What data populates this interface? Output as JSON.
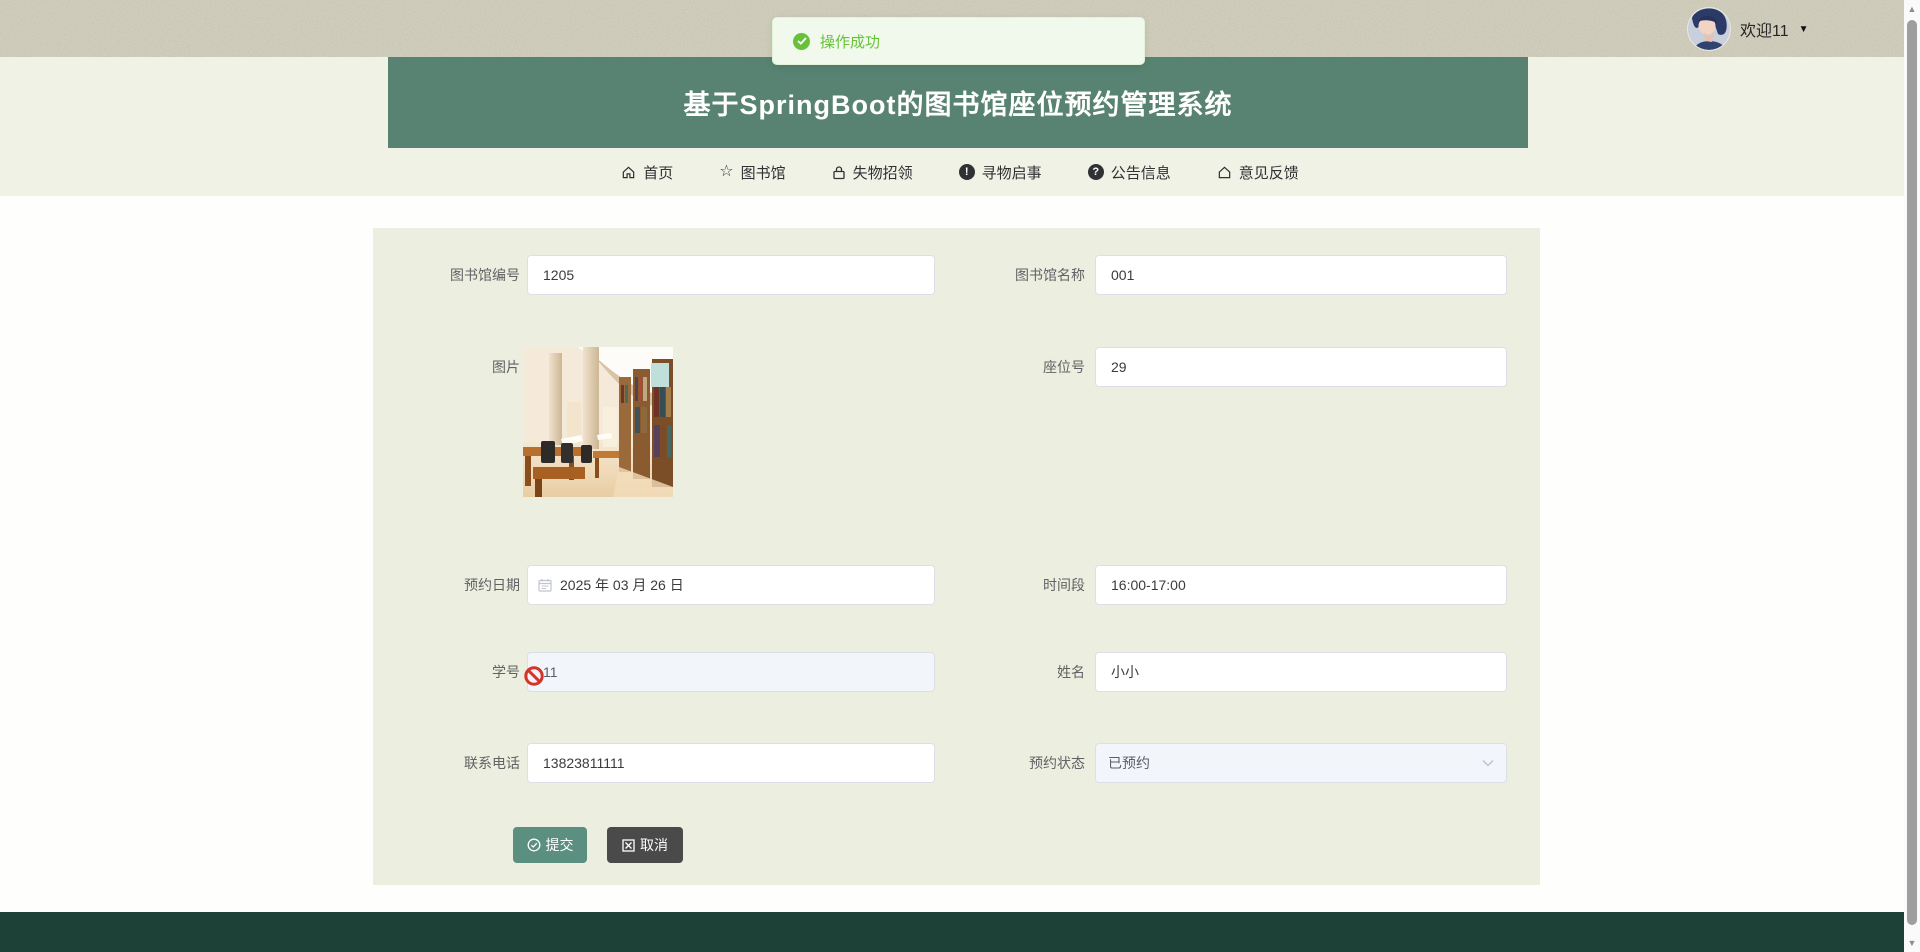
{
  "toast": {
    "message": "操作成功"
  },
  "user": {
    "welcome": "欢迎11"
  },
  "header": {
    "title": "基于SpringBoot的图书馆座位预约管理系统"
  },
  "nav": {
    "items": [
      {
        "label": "首页"
      },
      {
        "label": "图书馆"
      },
      {
        "label": "失物招领"
      },
      {
        "label": "寻物启事"
      },
      {
        "label": "公告信息"
      },
      {
        "label": "意见反馈"
      }
    ]
  },
  "icons": {
    "star": "☆",
    "info_glyph": "!",
    "question_glyph": "?",
    "caret_down": "▼",
    "scroll_up": "▲",
    "scroll_down": "▼"
  },
  "form": {
    "fields": {
      "library_no": {
        "label": "图书馆编号",
        "value": "1205"
      },
      "library_name": {
        "label": "图书馆名称",
        "value": "001"
      },
      "picture": {
        "label": "图片"
      },
      "seat_no": {
        "label": "座位号",
        "value": "29"
      },
      "reserve_date": {
        "label": "预约日期",
        "value": "2025 年 03 月 26 日"
      },
      "time_slot": {
        "label": "时间段",
        "value": "16:00-17:00"
      },
      "student_no": {
        "label": "学号",
        "value": "11"
      },
      "name": {
        "label": "姓名",
        "value": "小小"
      },
      "phone": {
        "label": "联系电话",
        "value": "13823811111"
      },
      "status": {
        "label": "预约状态",
        "value": "已预约"
      }
    },
    "buttons": {
      "submit": "提交",
      "cancel": "取消"
    }
  },
  "colors": {
    "brand_teal": "#588271",
    "btn_submit": "#5b8f7f",
    "btn_cancel": "#4a4a4b",
    "footer_green": "#1d4136",
    "success_green": "#67c23a",
    "toast_bg": "#f0f9eb",
    "toast_border": "#e1f3d8",
    "band_bg": "#f0f2e6",
    "panel_bg": "#eceedf",
    "texture_base": "#d8d5c3",
    "input_border": "#dcdfe6",
    "label_gray": "#606266",
    "disabled_bg": "#f2f5f9"
  }
}
